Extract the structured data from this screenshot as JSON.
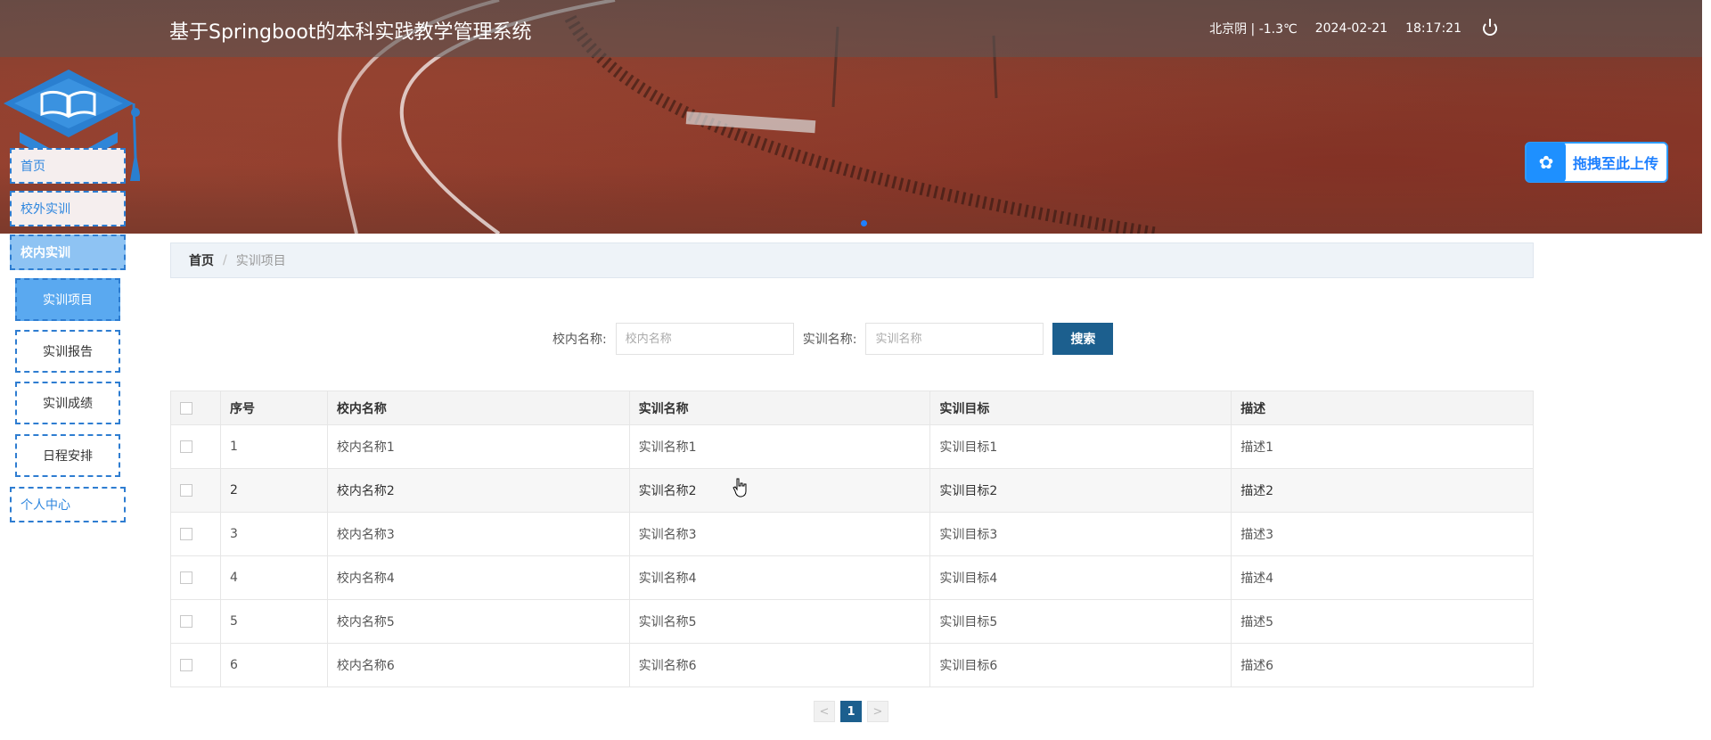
{
  "header": {
    "title": "基于Springboot的本科实践教学管理系统",
    "weather": "北京阴 | -1.3℃",
    "date": "2024-02-21",
    "time": "18:17:21",
    "power_icon": "power-icon"
  },
  "upload": {
    "label": "拖拽至此上传",
    "icon": "cloud-upload-icon"
  },
  "sidebar": {
    "items": [
      {
        "label": "首页"
      },
      {
        "label": "校外实训"
      },
      {
        "label": "校内实训"
      }
    ],
    "sub_items": [
      {
        "label": "实训项目"
      },
      {
        "label": "实训报告"
      },
      {
        "label": "实训成绩"
      },
      {
        "label": "日程安排"
      }
    ],
    "personal": "个人中心"
  },
  "breadcrumb": {
    "home": "首页",
    "sep": "/",
    "current": "实训项目"
  },
  "search": {
    "school_label": "校内名称:",
    "school_placeholder": "校内名称",
    "training_label": "实训名称:",
    "training_placeholder": "实训名称",
    "button": "搜索"
  },
  "table": {
    "headers": [
      "序号",
      "校内名称",
      "实训名称",
      "实训目标",
      "描述"
    ],
    "rows": [
      [
        "1",
        "校内名称1",
        "实训名称1",
        "实训目标1",
        "描述1"
      ],
      [
        "2",
        "校内名称2",
        "实训名称2",
        "实训目标2",
        "描述2"
      ],
      [
        "3",
        "校内名称3",
        "实训名称3",
        "实训目标3",
        "描述3"
      ],
      [
        "4",
        "校内名称4",
        "实训名称4",
        "实训目标4",
        "描述4"
      ],
      [
        "5",
        "校内名称5",
        "实训名称5",
        "实训目标5",
        "描述5"
      ],
      [
        "6",
        "校内名称6",
        "实训名称6",
        "实训目标6",
        "描述6"
      ]
    ]
  },
  "pager": {
    "prev": "<",
    "current": "1",
    "next": ">"
  },
  "colors": {
    "primary": "#1c5f8e",
    "sidebar_border": "#2e7dd1",
    "active_sub": "#5aa9f0"
  }
}
